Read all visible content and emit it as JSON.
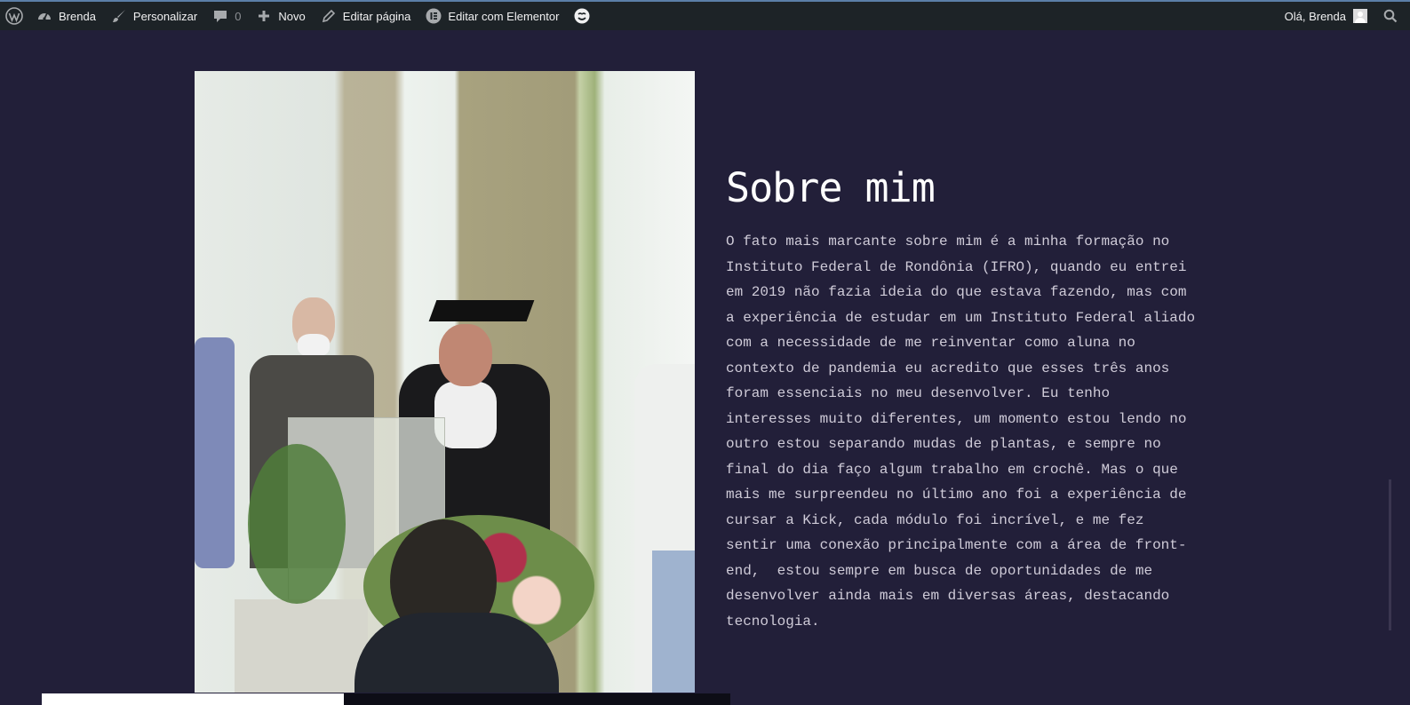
{
  "admin_bar": {
    "site_name": "Brenda",
    "customize_label": "Personalizar",
    "comments_count": "0",
    "new_label": "Novo",
    "edit_page_label": "Editar página",
    "edit_elementor_label": "Editar com Elementor",
    "greeting": "Olá, Brenda",
    "icons": [
      "wordpress-logo-icon",
      "dashboard-icon",
      "brush-icon",
      "comment-icon",
      "plus-icon",
      "pencil-icon",
      "elementor-icon",
      "theme-icon",
      "search-icon"
    ]
  },
  "about": {
    "title": "Sobre mim",
    "text": "O fato mais marcante sobre mim é a minha formação no\nInstituto Federal de Rondônia (IFRO), quando eu entrei\nem 2019 não fazia ideia do que estava fazendo, mas com\na experiência de estudar em um Instituto Federal aliado\ncom a necessidade de me reinventar como aluna no\ncontexto de pandemia eu acredito que esses três anos\nforam essenciais no meu desenvolver. Eu tenho\ninteresses muito diferentes, um momento estou lendo no\noutro estou separando mudas de plantas, e sempre no\nfinal do dia faço algum trabalho em crochê. Mas o que\nmais me surpreendeu no último ano foi a experiência de\ncursar a Kick, cada módulo foi incrível, e me fez\nsentir uma conexão principalmente com a área de front-\nend,  estou sempre em busca de oportunidades de me\ndesenvolver ainda mais em diversas áreas, destacando\ntecnologia."
  },
  "colors": {
    "page_background": "#221f39",
    "admin_bar_background": "#1d2327",
    "title_color": "#ffffff",
    "text_color": "#cfcbd8"
  }
}
